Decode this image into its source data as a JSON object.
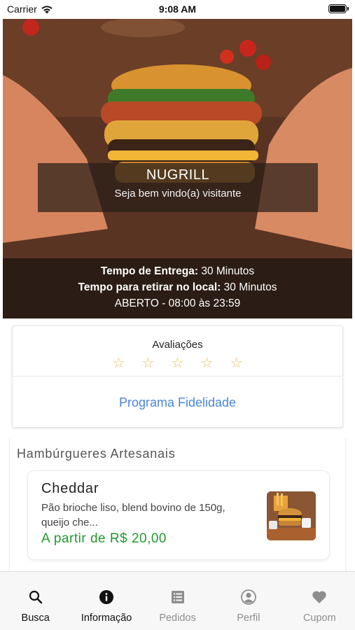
{
  "status_bar": {
    "carrier": "Carrier",
    "time": "9:08 AM",
    "battery_level": 1.0
  },
  "hero": {
    "restaurant_name": "NUGRILL",
    "welcome": "Seja bem vindo(a) visitante",
    "delivery_time_label": "Tempo de Entrega:",
    "delivery_time_value": " 30 Minutos",
    "pickup_time_label": "Tempo para retirar no local:",
    "pickup_time_value": " 30 Minutos",
    "hours": "ABERTO - 08:00 às 23:59"
  },
  "ratings": {
    "title": "Avaliações",
    "stars": [
      "☆",
      "☆",
      "☆",
      "☆",
      "☆"
    ],
    "filled": 0,
    "star_color": "#e6c15a"
  },
  "loyalty": {
    "label": "Programa Fidelidade",
    "color": "#4a86d8"
  },
  "category": {
    "title": "Hambúrgueres Artesanais",
    "products": [
      {
        "name": "Cheddar",
        "description": "Pão brioche liso, blend bovino de 150g, queijo che...",
        "price": "A partir de R$ 20,00",
        "price_color": "#1f9a2e"
      }
    ]
  },
  "tab_bar": {
    "tabs": [
      {
        "label": "Busca",
        "icon": "search-icon",
        "active": true
      },
      {
        "label": "Informação",
        "icon": "info-icon",
        "active": true
      },
      {
        "label": "Pedidos",
        "icon": "orders-icon",
        "active": false
      },
      {
        "label": "Perfil",
        "icon": "profile-icon",
        "active": false
      },
      {
        "label": "Cupom",
        "icon": "heart-icon",
        "active": false
      }
    ]
  }
}
